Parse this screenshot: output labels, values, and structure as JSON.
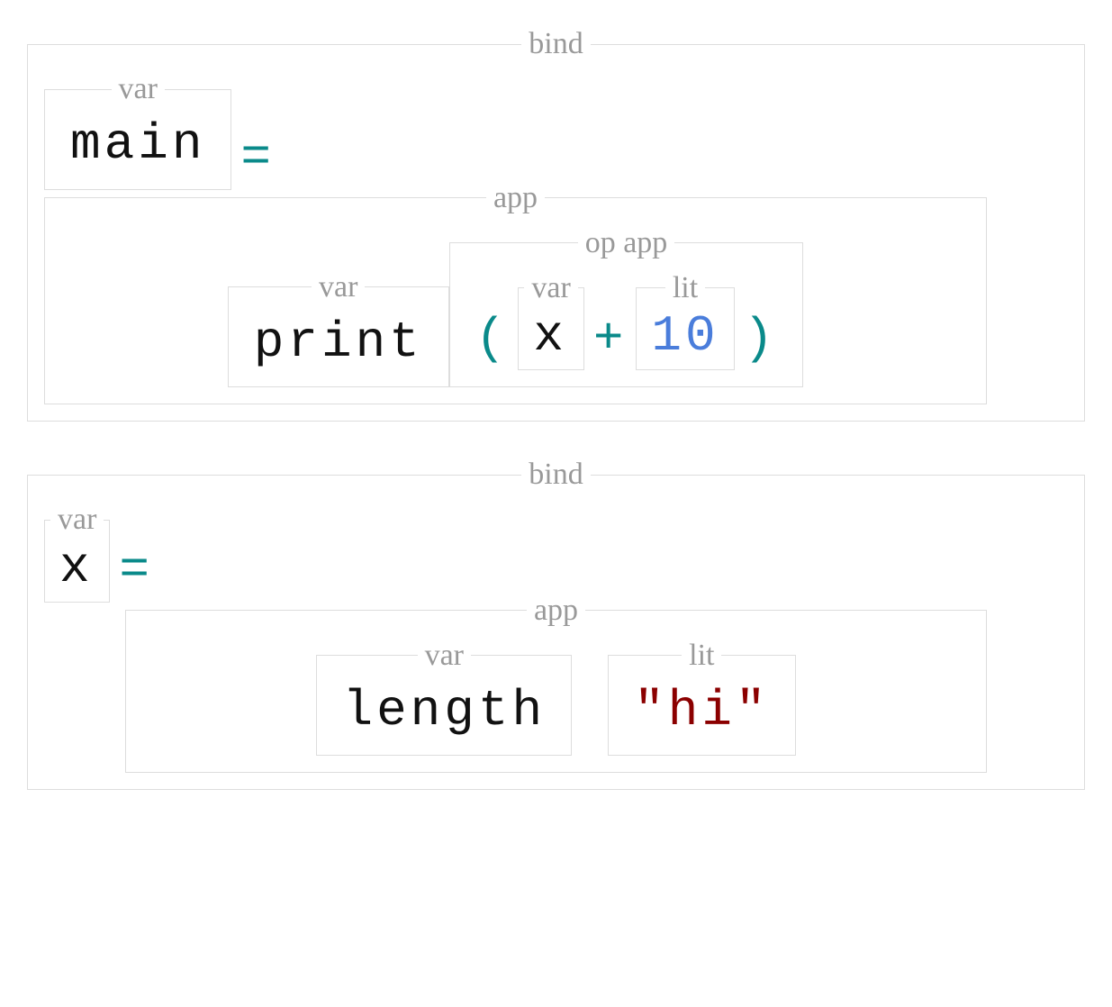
{
  "labels": {
    "bind": "bind",
    "var": "var",
    "app": "app",
    "op_app": "op app",
    "lit": "lit"
  },
  "symbols": {
    "eq": "=",
    "plus": "+",
    "lparen": "(",
    "rparen": ")"
  },
  "bind1": {
    "name": "main",
    "app": {
      "fn": "print",
      "op_app": {
        "left": "x",
        "op": "+",
        "right": "10"
      }
    }
  },
  "bind2": {
    "name": "x",
    "app": {
      "fn": "length",
      "arg": "\"hi\""
    }
  }
}
